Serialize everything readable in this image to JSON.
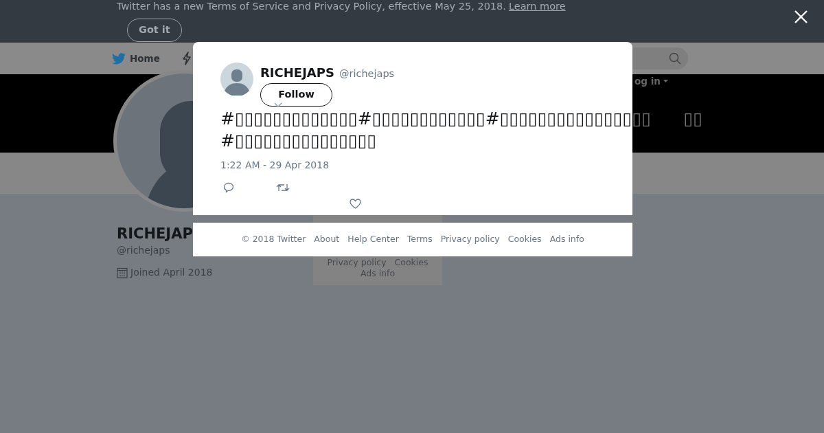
{
  "notice": {
    "text": "Twitter has a new Terms of Service and Privacy Policy, effective May 25, 2018.",
    "link": "Learn more",
    "button": "Got it"
  },
  "nav": {
    "home": "Home",
    "login": "og in"
  },
  "profile": {
    "name": "RICHEJAP",
    "handle": "@richejaps",
    "joined": "Joined April 2018"
  },
  "side_footer": {
    "links": [
      "Privacy policy",
      "Cookies"
    ],
    "ads": "Ads info"
  },
  "tweet": {
    "name": "RICHEJAPS",
    "handle": "@richejaps",
    "follow": "Follow",
    "text": "#▯▯▯▯▯▯▯▯▯▯▯▯▯#▯▯▯▯▯▯▯▯▯▯▯▯#▯▯▯▯▯▯▯▯▯▯▯▯▯▯▯▯      ▯▯ #▯▯▯▯▯▯▯▯▯▯▯▯▯▯▯",
    "time": "1:22 AM - 29 Apr 2018"
  },
  "footer": {
    "links": [
      "© 2018 Twitter",
      "About",
      "Help Center",
      "Terms",
      "Privacy policy",
      "Cookies",
      "Ads info"
    ]
  }
}
